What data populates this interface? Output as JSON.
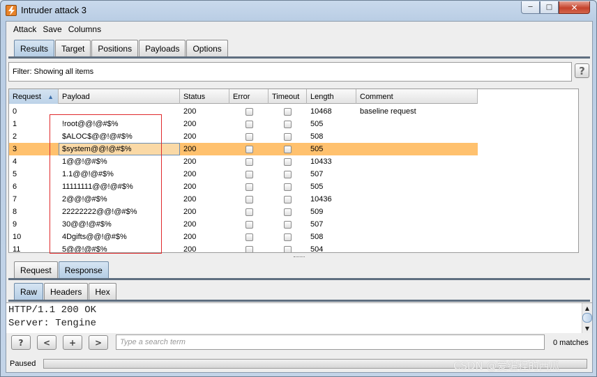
{
  "window": {
    "title": "Intruder attack 3"
  },
  "menu": [
    "Attack",
    "Save",
    "Columns"
  ],
  "main_tabs": [
    {
      "label": "Results"
    },
    {
      "label": "Target"
    },
    {
      "label": "Positions"
    },
    {
      "label": "Payloads"
    },
    {
      "label": "Options"
    }
  ],
  "filter": {
    "text": "Filter:  Showing all items",
    "help": "?"
  },
  "table": {
    "columns": [
      "Request",
      "Payload",
      "Status",
      "Error",
      "Timeout",
      "Length",
      "Comment"
    ],
    "sorted_column": "Request",
    "rows": [
      {
        "request": "0",
        "payload": "",
        "status": "200",
        "length": "10468",
        "comment": "baseline request"
      },
      {
        "request": "1",
        "payload": "!root@@!@#$%",
        "status": "200",
        "length": "505",
        "comment": ""
      },
      {
        "request": "2",
        "payload": "$ALOC$@@!@#$%",
        "status": "200",
        "length": "508",
        "comment": ""
      },
      {
        "request": "3",
        "payload": "$system@@!@#$%",
        "status": "200",
        "length": "505",
        "comment": ""
      },
      {
        "request": "4",
        "payload": "1@@!@#$%",
        "status": "200",
        "length": "10433",
        "comment": ""
      },
      {
        "request": "5",
        "payload": "1.1@@!@#$%",
        "status": "200",
        "length": "507",
        "comment": ""
      },
      {
        "request": "6",
        "payload": "11111111@@!@#$%",
        "status": "200",
        "length": "505",
        "comment": ""
      },
      {
        "request": "7",
        "payload": "2@@!@#$%",
        "status": "200",
        "length": "10436",
        "comment": ""
      },
      {
        "request": "8",
        "payload": "22222222@@!@#$%",
        "status": "200",
        "length": "509",
        "comment": ""
      },
      {
        "request": "9",
        "payload": "30@@!@#$%",
        "status": "200",
        "length": "507",
        "comment": ""
      },
      {
        "request": "10",
        "payload": "4Dgifts@@!@#$%",
        "status": "200",
        "length": "508",
        "comment": ""
      },
      {
        "request": "11",
        "payload": "5@@!@#$%",
        "status": "200",
        "length": "504",
        "comment": ""
      }
    ],
    "selected_request": "3"
  },
  "req_resp_tabs": [
    {
      "label": "Request"
    },
    {
      "label": "Response"
    }
  ],
  "view_tabs": [
    {
      "label": "Raw"
    },
    {
      "label": "Headers"
    },
    {
      "label": "Hex"
    }
  ],
  "response_lines": [
    "HTTP/1.1 200 OK",
    "Server: Tengine"
  ],
  "search": {
    "help": "?",
    "prev": "<",
    "add": "+",
    "next": ">",
    "placeholder": "Type a search term",
    "matches": "0 matches"
  },
  "status": {
    "text": "Paused",
    "progress": 0
  },
  "watermark": "CSDN @爱编程的西瓜",
  "colors": {
    "selected_row": "#ffc16e",
    "annotation_box": "#e0292b",
    "active_tab": "#b5cde4"
  }
}
